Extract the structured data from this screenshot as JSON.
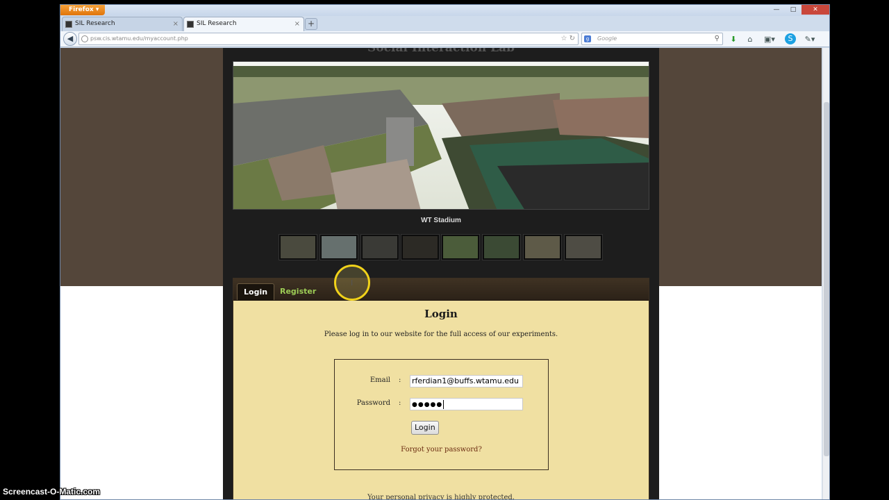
{
  "browser": {
    "firefox_button": "Firefox",
    "tabs": [
      {
        "title": "SIL Research"
      },
      {
        "title": "SIL Research"
      }
    ],
    "url": "psw.cis.wtamu.edu/myaccount.php",
    "search_engine": "Google",
    "search_placeholder": "Google",
    "icons": [
      "back-icon",
      "globe-icon",
      "star-icon",
      "reload-icon",
      "search-icon",
      "download-icon",
      "home-icon",
      "bookmarks-icon",
      "skype-icon",
      "menu-icon"
    ]
  },
  "page": {
    "site_title": "Social Interaction Lab",
    "slideshow": {
      "caption": "WT Stadium",
      "thumbnail_count": 8
    },
    "auth_tabs": [
      {
        "label": "Login",
        "active": true
      },
      {
        "label": "Register",
        "active": false
      }
    ],
    "login": {
      "heading": "Login",
      "intro": "Please log in to our website for the full access of our experiments.",
      "email_label": "Email",
      "email_value": "rferdian1@buffs.wtamu.edu",
      "password_label": "Password",
      "password_masked": "●●●●●",
      "colon": ":",
      "button_label": "Login",
      "forgot_link": "Forgot your password?"
    },
    "privacy_note": "Your personal privacy is highly protected."
  },
  "overlay": {
    "watermark": "Screencast-O-Matic.com"
  },
  "colors": {
    "page_brown": "#54463a",
    "content_dark": "#1d1d1d",
    "panel_tan": "#f0e0a2",
    "register_green": "#9ccb55",
    "cursor_highlight": "#f1d21a"
  }
}
